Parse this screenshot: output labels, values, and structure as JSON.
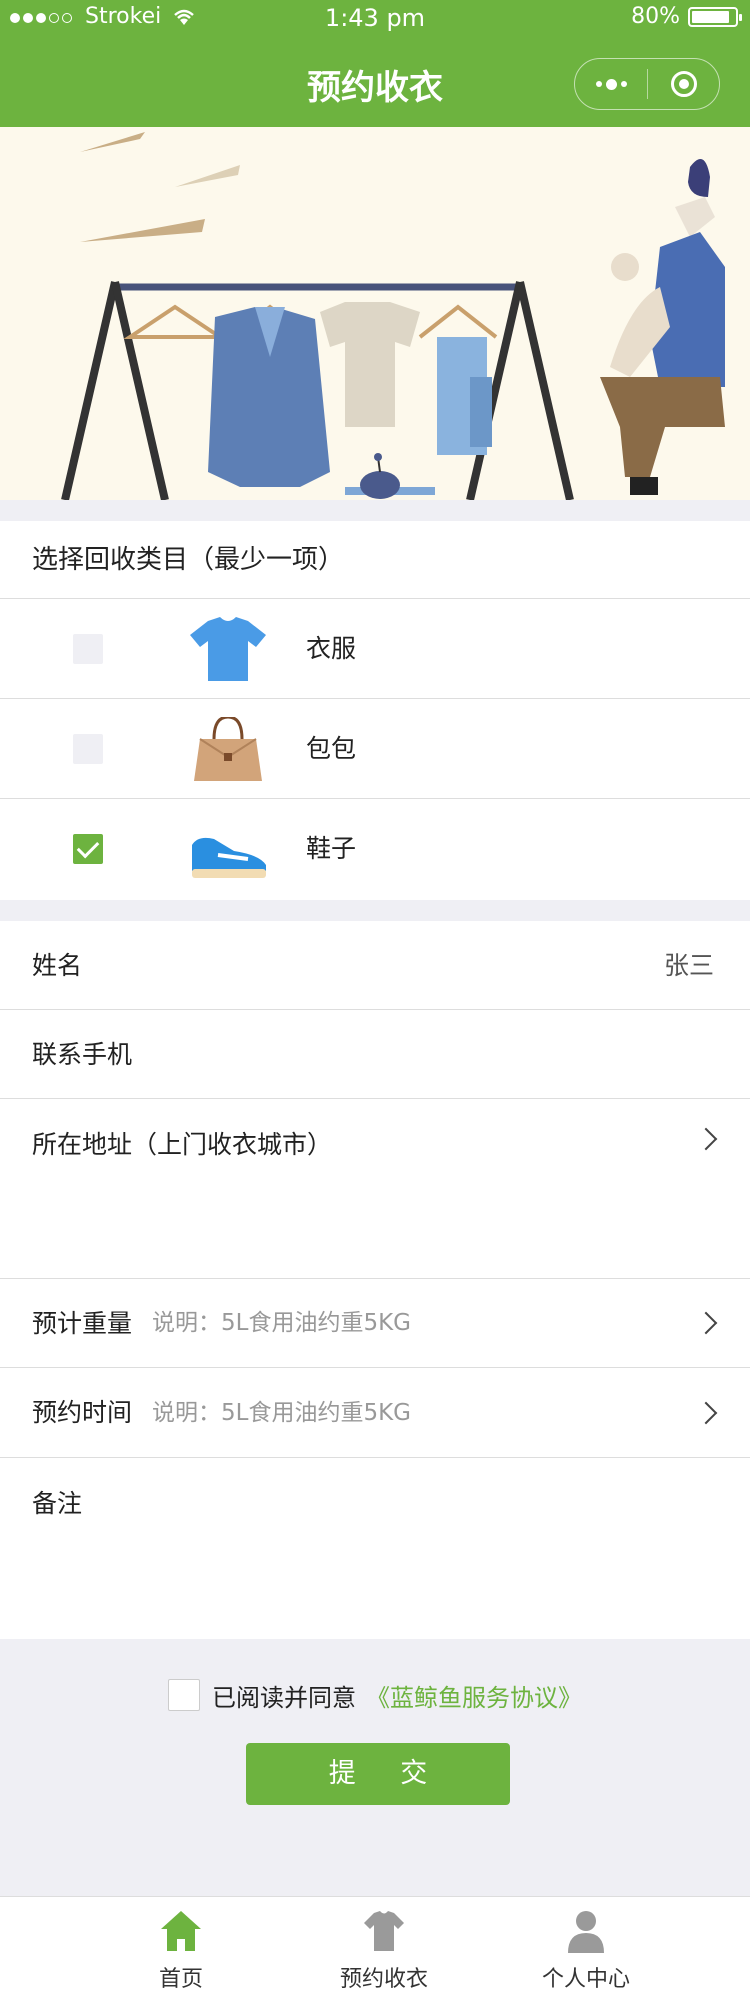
{
  "status_bar": {
    "carrier": "Strokei",
    "time": "1:43 pm",
    "battery": "80%"
  },
  "nav": {
    "title": "预约收衣",
    "more_icon": "more-dots-icon",
    "close_icon": "capsule-close-icon"
  },
  "categories": {
    "title": "选择回收类目（最少一项）",
    "items": [
      {
        "label": "衣服",
        "checked": false,
        "icon": "tshirt-icon"
      },
      {
        "label": "包包",
        "checked": false,
        "icon": "handbag-icon"
      },
      {
        "label": "鞋子",
        "checked": true,
        "icon": "sneaker-icon"
      }
    ]
  },
  "form": {
    "name_label": "姓名",
    "name_value": "张三",
    "phone_label": "联系手机",
    "address_label": "所在地址（上门收衣城市）",
    "weight_label": "预计重量",
    "weight_hint": "说明：5L食用油约重5KG",
    "time_label": "预约时间",
    "time_hint": "说明：5L食用油约重5KG",
    "remark_label": "备注"
  },
  "agreement": {
    "text": "已阅读并同意",
    "link": "《蓝鲸鱼服务协议》"
  },
  "submit_label": "提 交",
  "tabbar": [
    {
      "label": "首页",
      "icon": "home-icon",
      "active": true
    },
    {
      "label": "预约收衣",
      "icon": "shirt-tab-icon",
      "active": false
    },
    {
      "label": "个人中心",
      "icon": "user-icon",
      "active": false
    }
  ],
  "colors": {
    "brand": "#6db33f",
    "background": "#efeff4"
  }
}
